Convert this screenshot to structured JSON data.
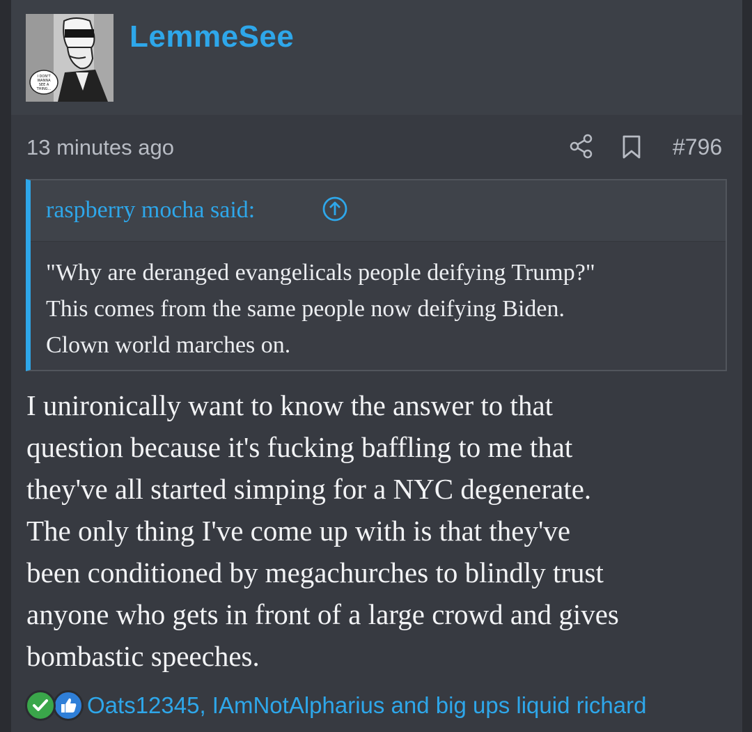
{
  "post": {
    "username": "LemmeSee",
    "avatar_bubble_text": "I DON'T WANNA SEE A THING...",
    "timestamp": "13 minutes ago",
    "post_number": "#796"
  },
  "quote": {
    "author_label": "raspberry mocha said:",
    "lines": [
      "\"Why are deranged evangelicals people deifying Trump?\"",
      "This comes from the same people now deifying Biden.",
      "Clown world marches on."
    ]
  },
  "body": {
    "lines": [
      "I unironically want to know the answer to that",
      "question because it's fucking baffling to me that",
      "they've all started simping for a NYC degenerate.",
      "The only thing I've come up with is that they've",
      "been conditioned by megachurches to blindly trust",
      "anyone who gets in front of a large crowd and gives",
      "bombastic speeches."
    ]
  },
  "reactions": {
    "reactors_text": "Oats12345, IAmNotAlpharius and big ups liquid richard",
    "icons": [
      "check-reaction-icon",
      "like-reaction-icon"
    ]
  },
  "colors": {
    "accent": "#2ea7ea",
    "background": "#373a41",
    "header_bg": "#3c4047",
    "quote_bg": "#3a3d44",
    "text": "#f2f3f5",
    "muted_text": "#b8bcc4"
  }
}
